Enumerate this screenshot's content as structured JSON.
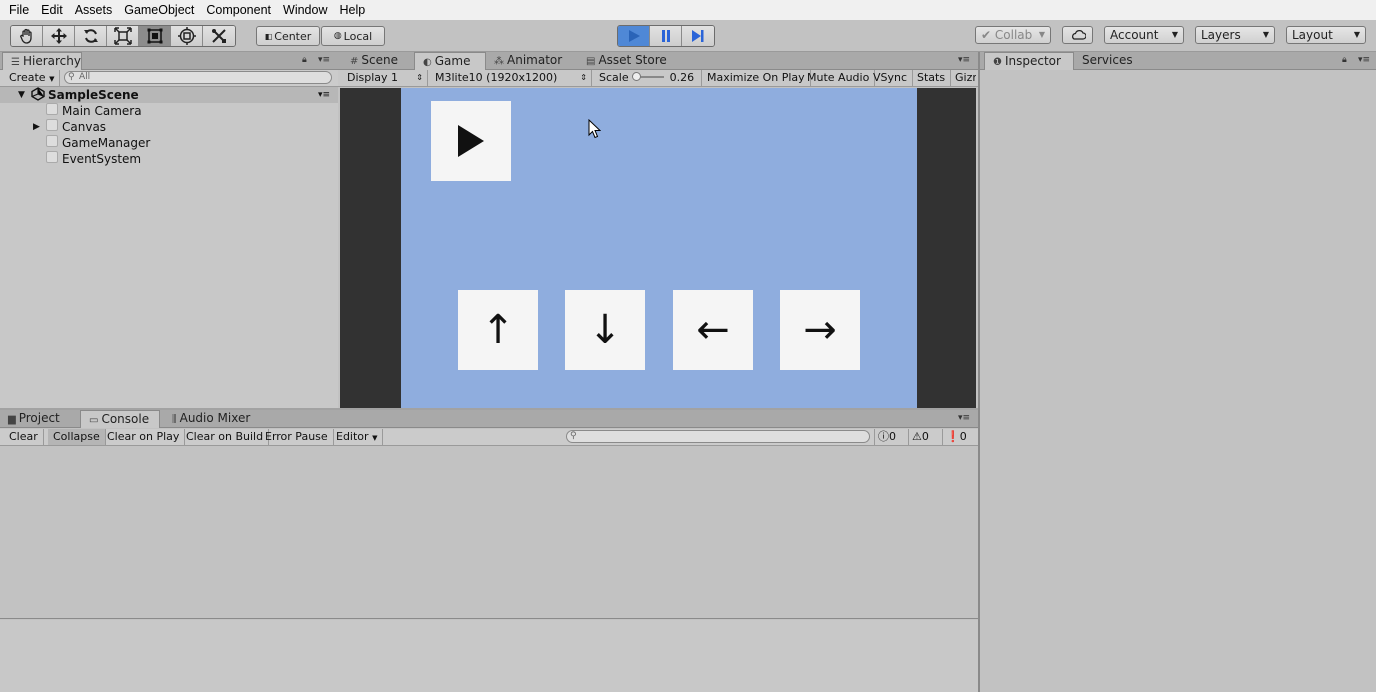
{
  "menu": [
    "File",
    "Edit",
    "Assets",
    "GameObject",
    "Component",
    "Window",
    "Help"
  ],
  "toolbar": {
    "tools": [
      "hand-tool-icon",
      "move-tool-icon",
      "rotate-tool-icon",
      "scale-tool-icon",
      "rect-tool-icon",
      "transform-tool-icon",
      "custom-tool-icon"
    ],
    "active_tool": "rect-tool-icon",
    "pivot": "Center",
    "space": "Local",
    "collab": "Collab",
    "account": "Account",
    "layers": "Layers",
    "layout": "Layout",
    "play_state": "playing",
    "accent": "#4f88d6"
  },
  "hierarchy": {
    "tab": "Hierarchy",
    "create": "Create",
    "search_placeholder": "All",
    "scene": "SampleScene",
    "items": [
      "Main Camera",
      "Canvas",
      "GameManager",
      "EventSystem"
    ]
  },
  "center_tabs": [
    "Scene",
    "Game",
    "Animator",
    "Asset Store"
  ],
  "active_center_tab": "Game",
  "game_bar": {
    "display": "Display 1",
    "resolution": "M3lite10 (1920x1200)",
    "scale_label": "Scale",
    "scale_value": "0.26",
    "maximize": "Maximize On Play",
    "mute": "Mute Audio",
    "vsync": "VSync",
    "stats": "Stats",
    "gizmos": "Gizr"
  },
  "game_view": {
    "background": "#8fadde",
    "buttons": [
      "↑",
      "↓",
      "←",
      "→"
    ]
  },
  "right_tabs": [
    "Inspector",
    "Services"
  ],
  "bottom_tabs": [
    "Project",
    "Console",
    "Audio Mixer"
  ],
  "console_bar": {
    "clear": "Clear",
    "collapse": "Collapse",
    "clear_on_play": "Clear on Play",
    "clear_on_build": "Clear on Build",
    "error_pause": "Error Pause",
    "editor": "Editor",
    "info_count": "0",
    "warn_count": "0",
    "error_count": "0"
  }
}
